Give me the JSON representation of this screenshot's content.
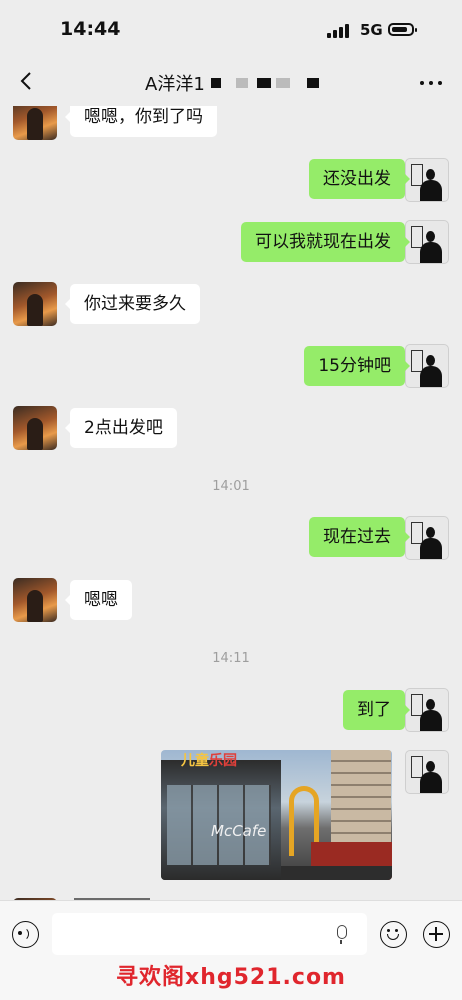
{
  "status_bar": {
    "time": "14:44",
    "network": "5G"
  },
  "header": {
    "title": "A洋洋1"
  },
  "messages": [
    {
      "from": "peer",
      "text": "嗯嗯，你到了吗"
    },
    {
      "from": "self",
      "text": "还没出发"
    },
    {
      "from": "self",
      "text": "可以我就现在出发"
    },
    {
      "from": "peer",
      "text": "你过来要多久"
    },
    {
      "from": "self",
      "text": "15分钟吧"
    },
    {
      "from": "peer",
      "text": "2点出发吧"
    },
    {
      "time": "14:01"
    },
    {
      "from": "self",
      "text": "现在过去"
    },
    {
      "from": "peer",
      "text": "嗯嗯"
    },
    {
      "time": "14:11"
    },
    {
      "from": "self",
      "text": "到了"
    },
    {
      "from": "self",
      "type": "image",
      "image_text": {
        "sign_part1": "儿童",
        "sign_part2": "乐园",
        "cafe": "McCafe"
      }
    }
  ],
  "input": {
    "placeholder": ""
  },
  "watermark": "寻欢阁xhg521.com",
  "colors": {
    "background": "#ededed",
    "self_bubble": "#95ec69",
    "peer_bubble": "#ffffff",
    "watermark": "#e0262d"
  },
  "icons": [
    "back-icon",
    "more-icon",
    "voice-icon",
    "mic-icon",
    "emoji-icon",
    "plus-icon"
  ]
}
